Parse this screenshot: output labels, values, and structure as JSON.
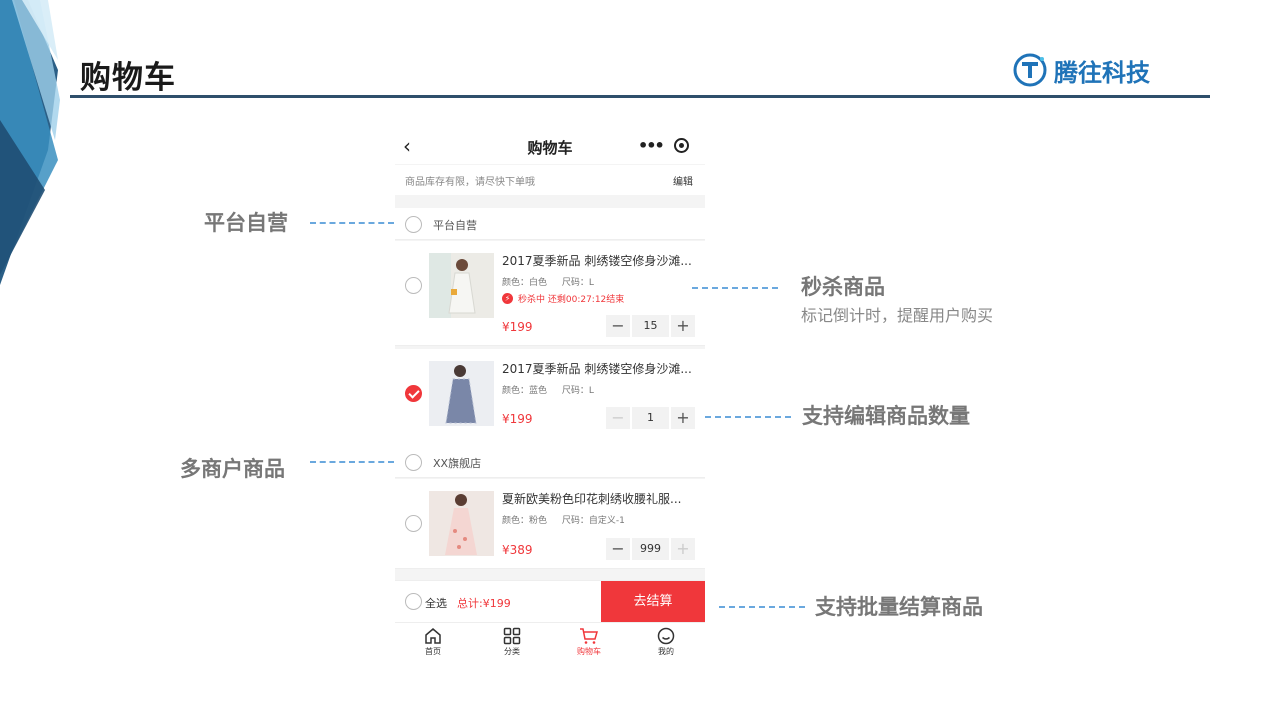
{
  "slide": {
    "title": "购物车",
    "logo_text": "腾往科技"
  },
  "phone": {
    "nav": {
      "title": "购物车"
    },
    "notice": {
      "text": "商品库存有限，请尽快下单哦",
      "edit": "编辑"
    },
    "shops": [
      {
        "name": "平台自营",
        "items": [
          {
            "title": "2017夏季新品 刺绣镂空修身沙滩...",
            "color": "颜色：白色",
            "size": "尺码：L",
            "flash": "秒杀中 还剩00:27:12结束",
            "price": "¥199",
            "qty": "15",
            "checked": false
          },
          {
            "title": "2017夏季新品 刺绣镂空修身沙滩...",
            "color": "颜色：蓝色",
            "size": "尺码：L",
            "price": "¥199",
            "qty": "1",
            "checked": true
          }
        ]
      },
      {
        "name": "XX旗舰店",
        "items": [
          {
            "title": "夏新欧美粉色印花刺绣收腰礼服...",
            "color": "颜色：粉色",
            "size": "尺码：自定义-1",
            "price": "¥389",
            "qty": "999",
            "checked": false
          }
        ]
      }
    ],
    "bottom": {
      "select_all": "全选",
      "total": "总计:¥199",
      "checkout": "去结算"
    },
    "tabs": [
      {
        "label": "首页",
        "icon": "home-icon"
      },
      {
        "label": "分类",
        "icon": "grid-icon"
      },
      {
        "label": "购物车",
        "icon": "cart-icon",
        "active": true
      },
      {
        "label": "我的",
        "icon": "user-icon"
      }
    ]
  },
  "callouts": {
    "platform": "平台自营",
    "flash_title": "秒杀商品",
    "flash_sub": "标记倒计时，提醒用户购买",
    "edit_qty": "支持编辑商品数量",
    "multi_merchant": "多商户商品",
    "batch": "支持批量结算商品"
  },
  "colors": {
    "accent": "#f0373b",
    "title_rule": "#2f4f6b",
    "dash": "#6aa8de",
    "logo": "#1f73b8"
  }
}
